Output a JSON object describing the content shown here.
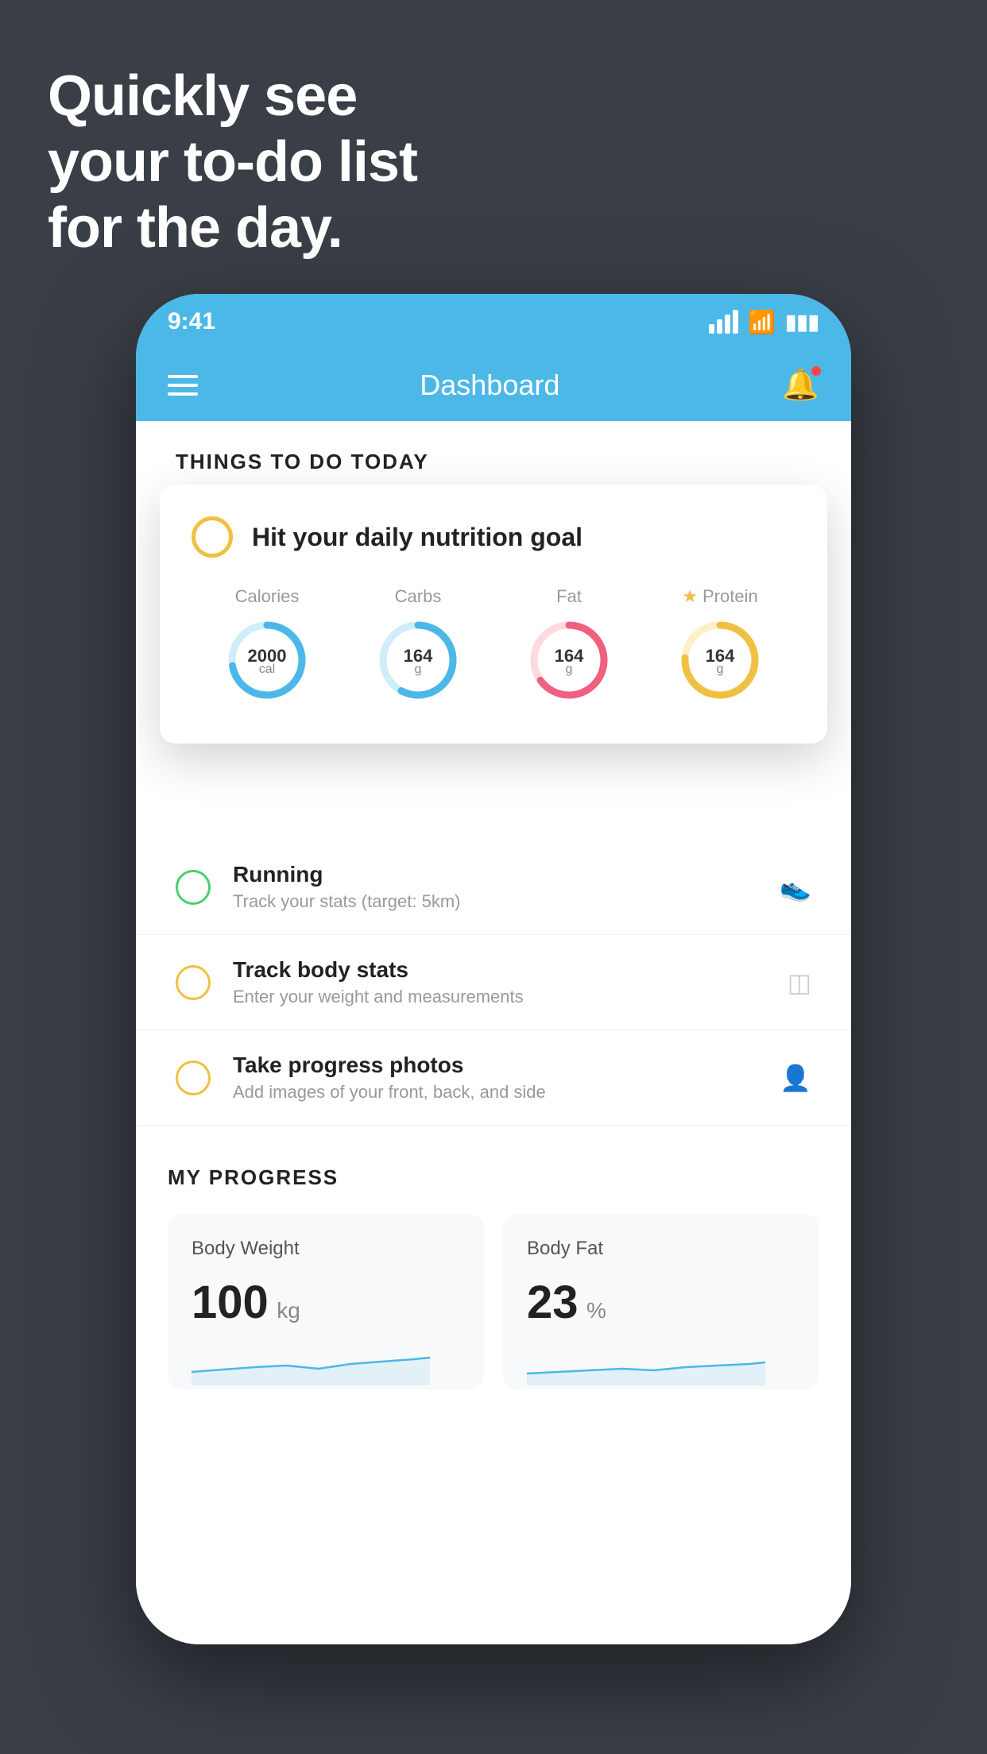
{
  "hero": {
    "line1": "Quickly see",
    "line2": "your to-do list",
    "line3": "for the day."
  },
  "phone": {
    "statusBar": {
      "time": "9:41"
    },
    "header": {
      "title": "Dashboard"
    },
    "sectionTitle": "THINGS TO DO TODAY",
    "nutritionCard": {
      "title": "Hit your daily nutrition goal",
      "nutrients": [
        {
          "label": "Calories",
          "value": "2000",
          "unit": "cal",
          "color": "#4cb8e8",
          "trackColor": "#d0edf9",
          "star": false
        },
        {
          "label": "Carbs",
          "value": "164",
          "unit": "g",
          "color": "#4cb8e8",
          "trackColor": "#d0edf9",
          "star": false
        },
        {
          "label": "Fat",
          "value": "164",
          "unit": "g",
          "color": "#f06080",
          "trackColor": "#fdd9e0",
          "star": false
        },
        {
          "label": "Protein",
          "value": "164",
          "unit": "g",
          "color": "#f0c040",
          "trackColor": "#fdf0c8",
          "star": true
        }
      ]
    },
    "todoItems": [
      {
        "id": "running",
        "title": "Running",
        "subtitle": "Track your stats (target: 5km)",
        "checkColor": "green",
        "iconType": "shoe"
      },
      {
        "id": "body-stats",
        "title": "Track body stats",
        "subtitle": "Enter your weight and measurements",
        "checkColor": "yellow",
        "iconType": "scale"
      },
      {
        "id": "progress-photo",
        "title": "Take progress photos",
        "subtitle": "Add images of your front, back, and side",
        "checkColor": "yellow",
        "iconType": "person"
      }
    ],
    "progressSection": {
      "title": "MY PROGRESS",
      "cards": [
        {
          "id": "body-weight",
          "title": "Body Weight",
          "value": "100",
          "unit": "kg"
        },
        {
          "id": "body-fat",
          "title": "Body Fat",
          "value": "23",
          "unit": "%"
        }
      ]
    }
  }
}
